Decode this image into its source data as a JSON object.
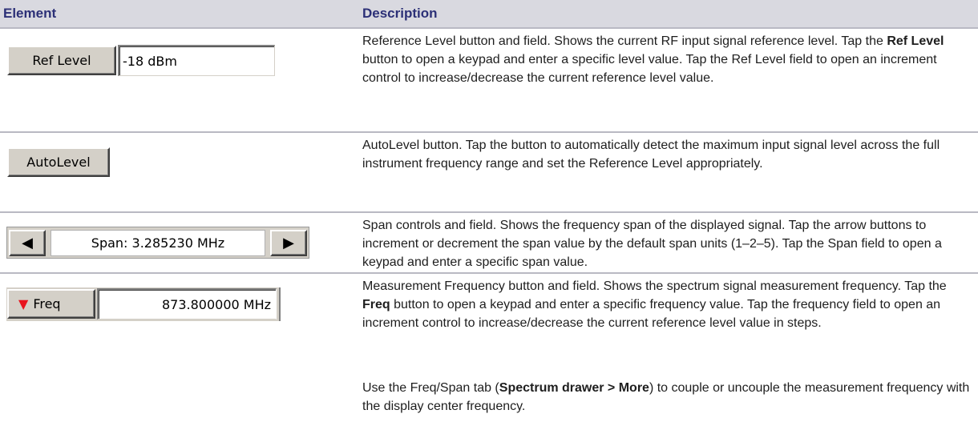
{
  "header": {
    "element": "Element",
    "description": "Description"
  },
  "rows": [
    {
      "button_label": "Ref Level",
      "field_value": "-18 dBm",
      "desc": {
        "t1": "Reference Level button and field. Shows the current RF input signal reference level. Tap the ",
        "b1": "Ref Level",
        "t2": " button to open a keypad and enter a specific level value. Tap the Ref Level field to open an increment control to increase/decrease the current reference level value."
      }
    },
    {
      "button_label": "AutoLevel",
      "desc": {
        "t1": "AutoLevel button. Tap the button to automatically detect the maximum input signal level across the full instrument frequency range and set the Reference Level appropriately."
      }
    },
    {
      "left_arrow": "◀",
      "field_value": "Span:  3.285230 MHz",
      "right_arrow": "▶",
      "desc": {
        "t1": "Span controls and field. Shows the frequency span of the displayed signal. Tap the arrow buttons to increment or decrement the span value by the default span units (1–2–5). Tap the Span field to open a keypad and enter a specific span value."
      }
    },
    {
      "button_icon": "▼",
      "button_label": "Freq",
      "field_value": "873.800000 MHz",
      "desc": {
        "t1": "Measurement Frequency button and field. Shows the spectrum signal measurement frequency. Tap the ",
        "b1": "Freq",
        "t2": " button to open a keypad and enter a specific frequency value. Tap the frequency field to open an increment control to increase/decrease the current reference level value in steps."
      },
      "desc2": {
        "t1": "Use the Freq/Span tab (",
        "b1": "Spectrum drawer > More",
        "t2": ") to couple or uncouple the measurement frequency with the display center frequency."
      }
    }
  ],
  "colors": {
    "header_bg": "#d9d9e0",
    "header_text": "#2c3077",
    "freq_triangle": "#e8141e",
    "button_face": "#d4d0c8"
  }
}
